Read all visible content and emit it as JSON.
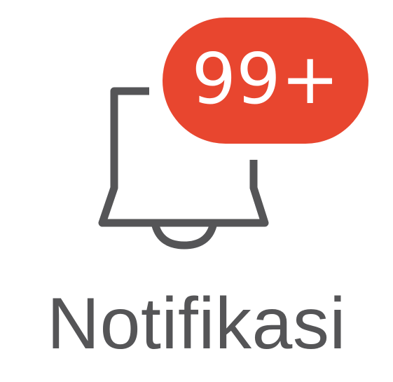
{
  "notification": {
    "label": "Notifikasi",
    "badge_count": "99+",
    "icon": "bell-icon"
  },
  "colors": {
    "badge_bg": "#e8462f",
    "badge_text": "#ffffff",
    "icon_stroke": "#555557",
    "label_text": "#555557",
    "background": "#ffffff"
  }
}
